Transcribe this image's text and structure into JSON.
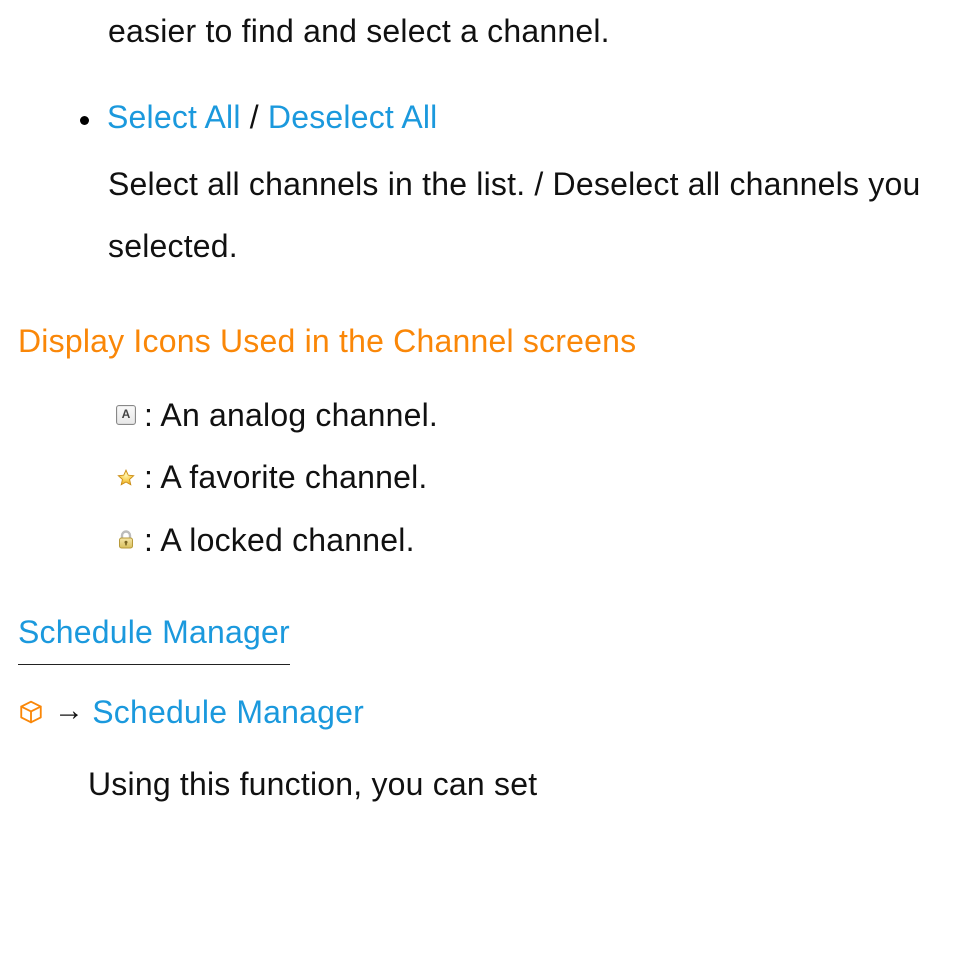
{
  "fragment_top": "easier to find and select a channel.",
  "select_all": {
    "label_a": "Select All",
    "sep": " / ",
    "label_b": "Deselect All",
    "body": "Select all channels in the list. / Deselect all channels you selected."
  },
  "icons_heading": "Display Icons Used in the Channel screens",
  "icon_rows": {
    "analog": {
      "badge": "A",
      "text": ": An analog channel."
    },
    "fav": {
      "text": ": A favorite channel."
    },
    "locked": {
      "text": ": A locked channel."
    }
  },
  "schedule": {
    "title": "Schedule Manager",
    "arrow": "→",
    "breadcrumb": "Schedule Manager",
    "body_start": "Using this function, you can set"
  },
  "colors": {
    "link": "#1b99dd",
    "accent": "#fa8708"
  }
}
